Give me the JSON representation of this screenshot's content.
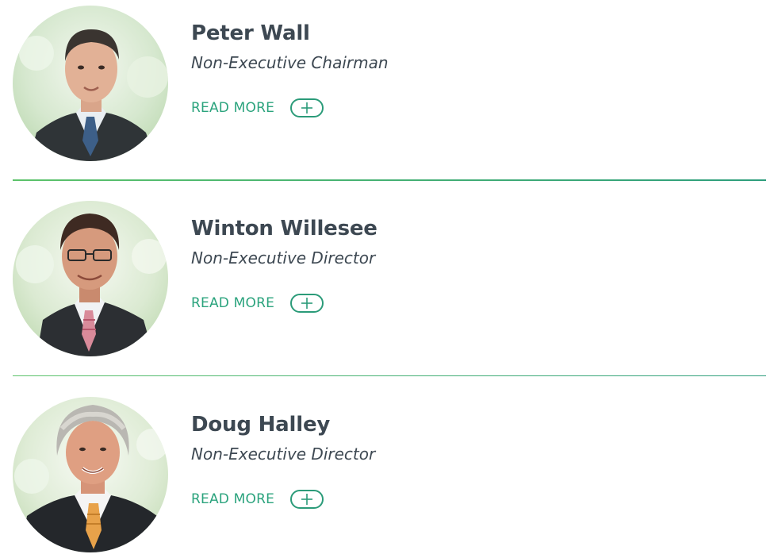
{
  "board_members": [
    {
      "name": "Peter Wall",
      "role": "Non-Executive Chairman",
      "read_more_label": "READ MORE",
      "expand_icon": "plus-icon",
      "photo_icon": "portrait-photo"
    },
    {
      "name": "Winton Willesee",
      "role": "Non-Executive Director",
      "read_more_label": "READ MORE",
      "expand_icon": "plus-icon",
      "photo_icon": "portrait-photo"
    },
    {
      "name": "Doug Halley",
      "role": "Non-Executive Director",
      "read_more_label": "READ MORE",
      "expand_icon": "plus-icon",
      "photo_icon": "portrait-photo"
    }
  ],
  "colors": {
    "accent_green": "#2ba37d",
    "divider_green": "#5cc36a",
    "text_dark": "#3d4852"
  }
}
